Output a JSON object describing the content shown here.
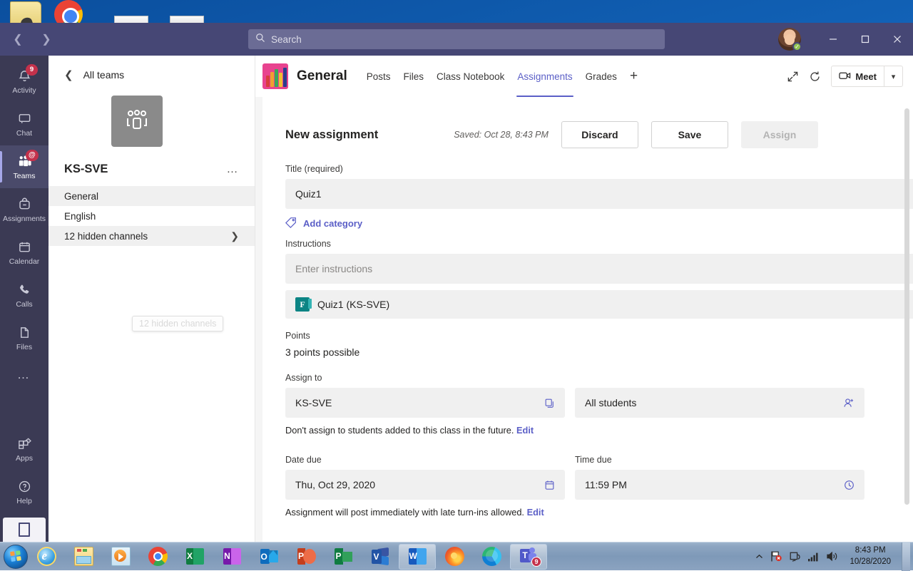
{
  "desktop": {
    "icons": [
      "folder-icon",
      "chrome-icon",
      "document-icon",
      "document-icon"
    ]
  },
  "titlebar": {
    "back_icon": "chevron-left-icon",
    "forward_icon": "chevron-right-icon",
    "search_placeholder": "Search",
    "search_icon": "search-icon",
    "presence": "available",
    "minimize": "minimize-icon",
    "maximize": "maximize-icon",
    "close": "close-icon"
  },
  "rail": {
    "items": [
      {
        "label": "Activity",
        "icon": "bell-icon",
        "badge": "9",
        "active": false
      },
      {
        "label": "Chat",
        "icon": "chat-icon",
        "badge": "",
        "active": false
      },
      {
        "label": "Teams",
        "icon": "teams-icon",
        "badge": "@",
        "active": true
      },
      {
        "label": "Assignments",
        "icon": "backpack-icon",
        "badge": "",
        "active": false
      },
      {
        "label": "Calendar",
        "icon": "calendar-icon",
        "badge": "",
        "active": false
      },
      {
        "label": "Calls",
        "icon": "phone-icon",
        "badge": "",
        "active": false
      },
      {
        "label": "Files",
        "icon": "files-icon",
        "badge": "",
        "active": false
      }
    ],
    "more": "…",
    "apps_label": "Apps",
    "help_label": "Help"
  },
  "sidebar": {
    "all_teams": "All teams",
    "team_name": "KS-SVE",
    "team_avatar_icon": "people-icon",
    "more_options": "…",
    "channels": [
      {
        "name": "General",
        "selected": true,
        "has_chevron": false
      },
      {
        "name": "English",
        "selected": false,
        "has_chevron": false
      },
      {
        "name": "12 hidden channels",
        "selected": true,
        "has_chevron": true
      }
    ],
    "tooltip": "12 hidden channels"
  },
  "channel_header": {
    "title": "General",
    "icon": "pencils-icon",
    "tabs": [
      {
        "label": "Posts",
        "active": false
      },
      {
        "label": "Files",
        "active": false
      },
      {
        "label": "Class Notebook",
        "active": false
      },
      {
        "label": "Assignments",
        "active": true
      },
      {
        "label": "Grades",
        "active": false
      }
    ],
    "add_tab": "+",
    "expand_icon": "expand-icon",
    "refresh_icon": "refresh-icon",
    "meet_label": "Meet",
    "meet_icon": "camera-icon",
    "meet_caret": "chevron-down-icon"
  },
  "assignment": {
    "heading": "New assignment",
    "saved_text": "Saved: Oct 28, 8:43 PM",
    "discard_label": "Discard",
    "save_label": "Save",
    "assign_label": "Assign",
    "title_label": "Title (required)",
    "title_value": "Quiz1",
    "add_category_label": "Add category",
    "add_category_icon": "tag-icon",
    "instructions_label": "Instructions",
    "instructions_placeholder": "Enter instructions",
    "attachment_name": "Quiz1 (KS-SVE)",
    "attachment_icon": "forms-icon",
    "points_label": "Points",
    "points_value": "3 points possible",
    "assign_to_label": "Assign to",
    "assign_to_team": "KS-SVE",
    "assign_to_team_icon": "copy-icon",
    "assign_to_students": "All students",
    "assign_to_students_icon": "add-person-icon",
    "future_note": "Don't assign to students added to this class in the future.",
    "future_note_link": "Edit",
    "date_due_label": "Date due",
    "date_due_value": "Thu, Oct 29, 2020",
    "date_icon": "calendar-icon",
    "time_due_label": "Time due",
    "time_due_value": "11:59 PM",
    "time_icon": "clock-icon",
    "post_note": "Assignment will post immediately with late turn-ins allowed.",
    "post_note_link": "Edit"
  },
  "taskbar": {
    "start": "start-orb",
    "items": [
      {
        "name": "internet-explorer",
        "active": false,
        "badge": ""
      },
      {
        "name": "file-explorer",
        "active": false,
        "badge": ""
      },
      {
        "name": "windows-media-player",
        "active": false,
        "badge": ""
      },
      {
        "name": "google-chrome",
        "active": false,
        "badge": ""
      },
      {
        "name": "excel",
        "active": false,
        "badge": ""
      },
      {
        "name": "onenote",
        "active": false,
        "badge": ""
      },
      {
        "name": "outlook",
        "active": false,
        "badge": ""
      },
      {
        "name": "powerpoint",
        "active": false,
        "badge": ""
      },
      {
        "name": "project",
        "active": false,
        "badge": ""
      },
      {
        "name": "visio",
        "active": false,
        "badge": ""
      },
      {
        "name": "word",
        "active": true,
        "badge": ""
      },
      {
        "name": "firefox",
        "active": false,
        "badge": ""
      },
      {
        "name": "microsoft-edge",
        "active": false,
        "badge": ""
      },
      {
        "name": "microsoft-teams",
        "active": true,
        "badge": "9"
      }
    ],
    "tray": [
      "show-hidden-icons",
      "network-error-icon",
      "action-center-icon",
      "signal-icon",
      "volume-icon"
    ],
    "time": "8:43 PM",
    "date": "10/28/2020"
  },
  "colors": {
    "teams_purple": "#464775",
    "rail_dark": "#3b3a54",
    "accent": "#5b5fc7",
    "badge_red": "#c4314b",
    "presence_green": "#92c353",
    "channel_pink": "#e8438f"
  }
}
